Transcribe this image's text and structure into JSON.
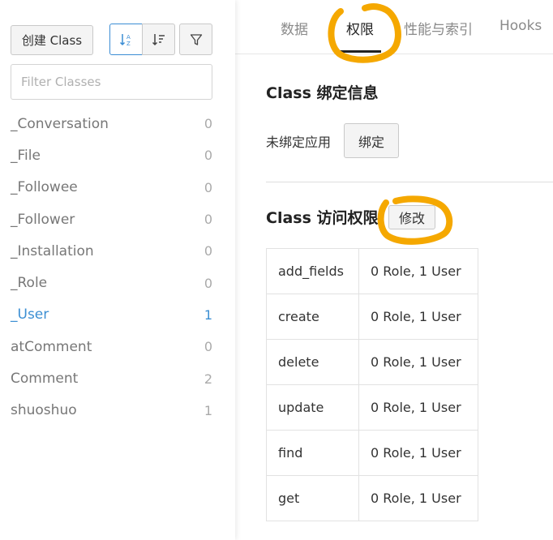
{
  "sidebar": {
    "create_label": "创建 Class",
    "filter_placeholder": "Filter Classes",
    "classes": [
      {
        "name": "_Conversation",
        "count": "0"
      },
      {
        "name": "_File",
        "count": "0"
      },
      {
        "name": "_Followee",
        "count": "0"
      },
      {
        "name": "_Follower",
        "count": "0"
      },
      {
        "name": "_Installation",
        "count": "0"
      },
      {
        "name": "_Role",
        "count": "0"
      },
      {
        "name": "_User",
        "count": "1"
      },
      {
        "name": "atComment",
        "count": "0"
      },
      {
        "name": "Comment",
        "count": "2"
      },
      {
        "name": "shuoshuo",
        "count": "1"
      }
    ],
    "active_class": "_User"
  },
  "tabs": [
    {
      "label": "数据"
    },
    {
      "label": "权限"
    },
    {
      "label": "性能与索引"
    },
    {
      "label": "Hooks"
    }
  ],
  "active_tab": "权限",
  "binding": {
    "title": "Class 绑定信息",
    "status_text": "未绑定应用",
    "button_label": "绑定"
  },
  "access": {
    "title": "Class 访问权限",
    "modify_label": "修改",
    "rows": [
      {
        "op": "add_fields",
        "value": "0 Role, 1 User"
      },
      {
        "op": "create",
        "value": "0 Role, 1 User"
      },
      {
        "op": "delete",
        "value": "0 Role, 1 User"
      },
      {
        "op": "update",
        "value": "0 Role, 1 User"
      },
      {
        "op": "find",
        "value": "0 Role, 1 User"
      },
      {
        "op": "get",
        "value": "0 Role, 1 User"
      }
    ]
  },
  "colors": {
    "accent": "#3c8fd3",
    "annotation": "#f5a800"
  }
}
